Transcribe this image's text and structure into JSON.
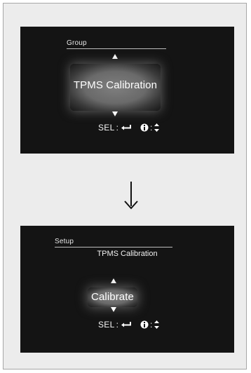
{
  "screens": {
    "top": {
      "header": "Group",
      "selection": "TPMS Calibration",
      "hint": {
        "select_label": "SEL",
        "colon1": ":",
        "colon2": ":"
      }
    },
    "bottom": {
      "header": "Setup",
      "subtitle": "TPMS Calibration",
      "selection": "Calibrate",
      "hint": {
        "select_label": "SEL",
        "colon1": ":",
        "colon2": ":"
      }
    }
  },
  "icons": {
    "transition": "arrow-down-icon",
    "enter": "enter-icon",
    "info": "info-icon",
    "updown": "up-down-icon"
  }
}
